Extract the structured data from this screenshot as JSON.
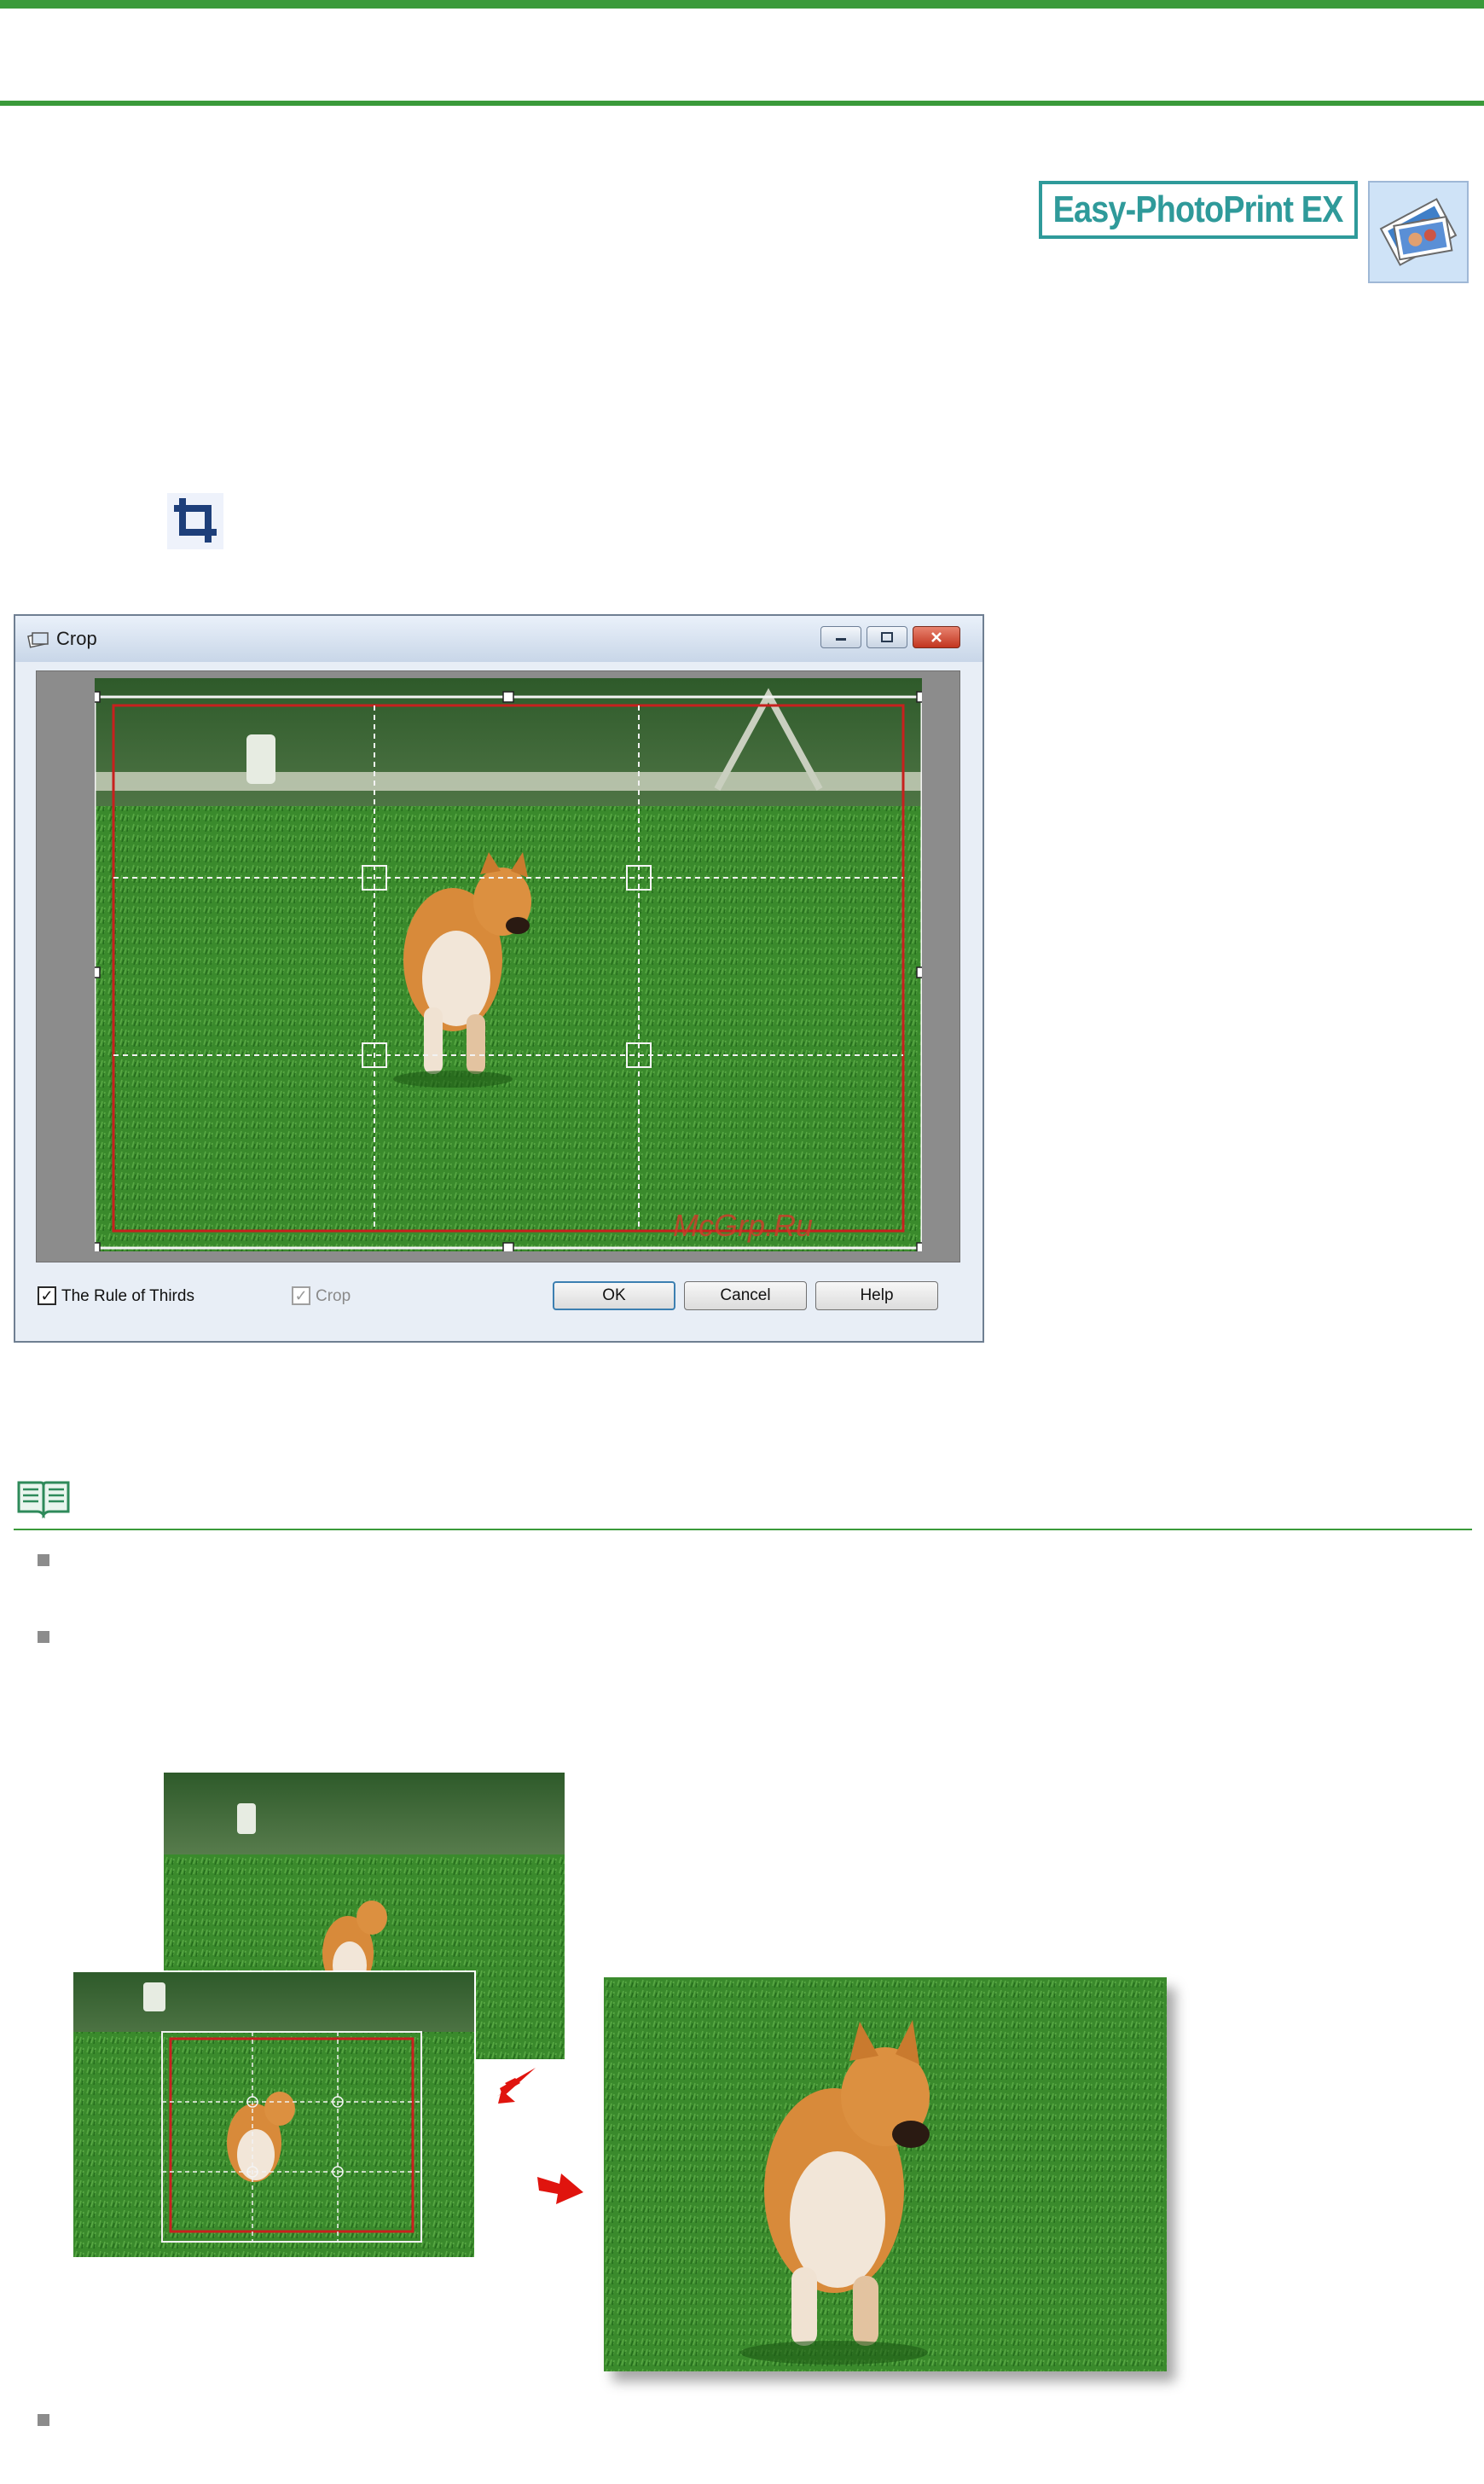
{
  "logo": {
    "text": "Easy-PhotoPrint EX",
    "thumbnail_icon": "photos-thumbnail-icon"
  },
  "toolbar_icon": "crop-icon",
  "crop_dialog": {
    "title": "Crop",
    "title_icon": "crop-app-icon",
    "window_controls": {
      "minimize": "minimize-icon",
      "maximize": "maximize-icon",
      "close": "close-icon"
    },
    "rule_of_thirds": {
      "label": "The Rule of Thirds",
      "checked": true
    },
    "crop": {
      "label": "Crop",
      "checked": true,
      "disabled": true
    },
    "buttons": {
      "ok": "OK",
      "cancel": "Cancel",
      "help": "Help"
    },
    "watermark": "McGrp.Ru"
  },
  "note": {
    "icon": "note-book-icon",
    "bullet_icon": "bullet-square-icon"
  },
  "colors": {
    "accent_green": "#3a9a3a",
    "logo_teal": "#2f9a9a",
    "crop_frame_red": "#c8201e",
    "arrow_red": "#e0140e"
  }
}
